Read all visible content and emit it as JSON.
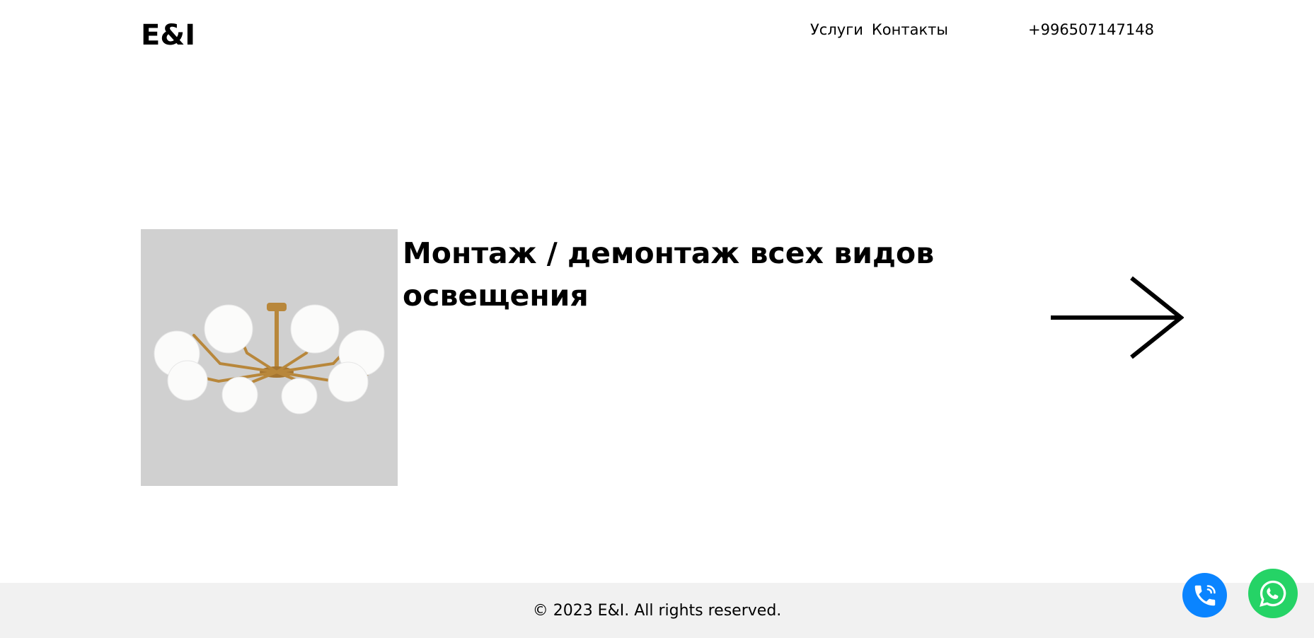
{
  "header": {
    "logo": "E&I",
    "nav": [
      {
        "label": "Услуги"
      },
      {
        "label": "Контакты"
      }
    ],
    "phone": "+996507147148"
  },
  "service": {
    "title": "Монтаж / демонтаж всех видов освещения",
    "image_icon": "chandelier-image",
    "arrow_icon": "arrow-right-icon"
  },
  "footer": {
    "copyright": "© 2023 E&I. All rights reserved."
  },
  "floating": {
    "call_icon": "phone-call-icon",
    "whatsapp_icon": "whatsapp-icon"
  },
  "colors": {
    "call_button": "#0a84ff",
    "whatsapp_button": "#25d366",
    "footer_bg": "#f1f1f1",
    "image_bg": "#d0d0d0",
    "brass": "#b8873b"
  }
}
